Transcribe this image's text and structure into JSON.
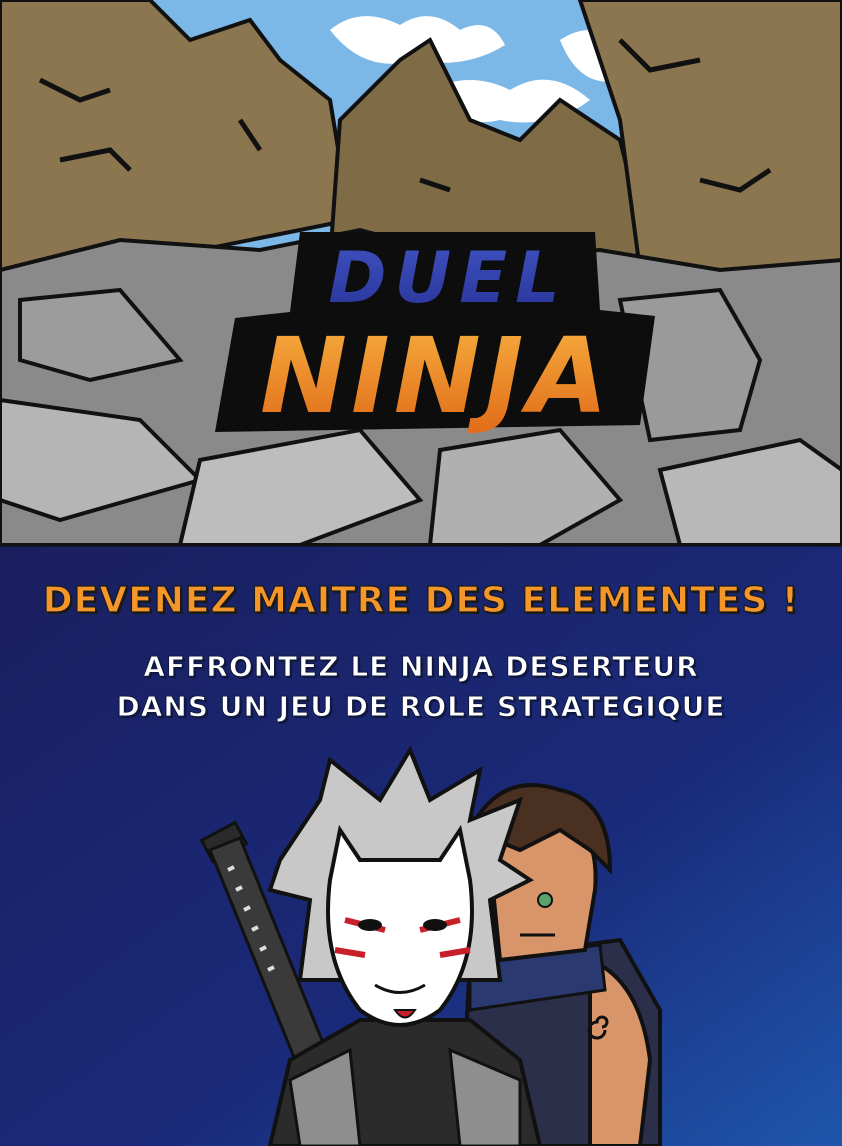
{
  "logo": {
    "line1": "DUEL",
    "line2": "NINJA"
  },
  "promo": {
    "headline": "DEVENEZ MAITRE DES ELEMENTES !",
    "subline1": "AFFRONTEZ LE NINJA DESERTEUR",
    "subline2": "DANS UN JEU DE ROLE STRATEGIQUE"
  },
  "colors": {
    "sky": "#7bb8e8",
    "rock_brown": "#8b7650",
    "rock_gray": "#8a8a8a",
    "panel_blue_dark": "#1a1f5e",
    "panel_blue_light": "#1e4fa0",
    "logo_blue": "#2b3a9a",
    "logo_orange": "#f08a20",
    "headline_orange": "#f5962a"
  },
  "icons": [
    "katana-icon",
    "fox-mask-icon",
    "spiral-tattoo-icon"
  ]
}
